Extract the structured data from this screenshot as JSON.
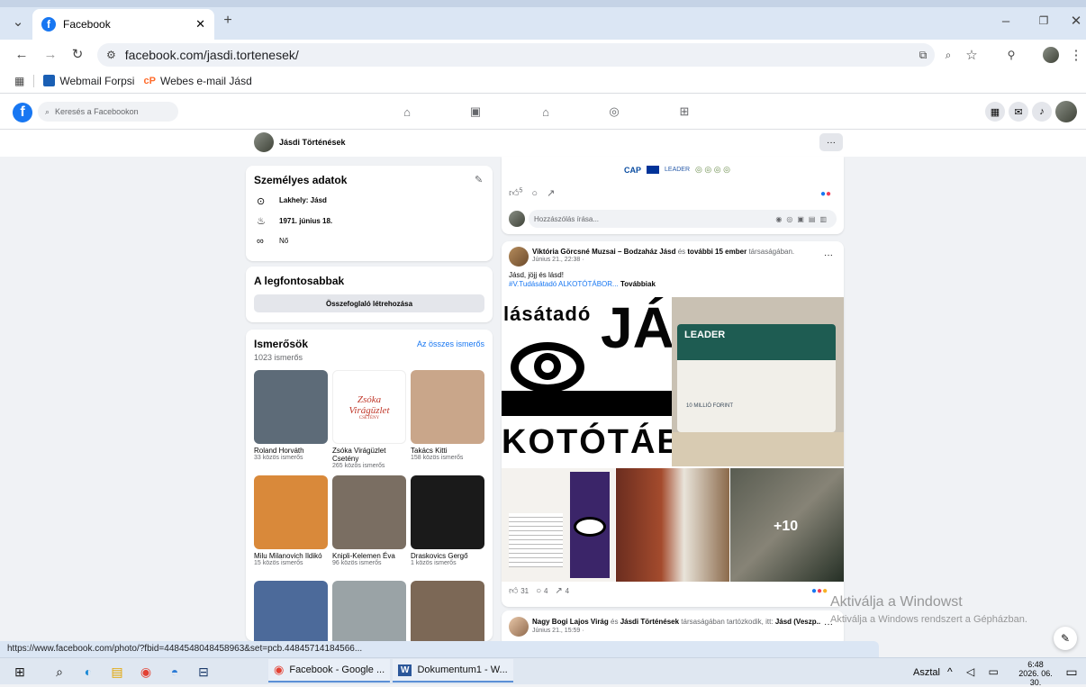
{
  "browser": {
    "tab_title": "Facebook",
    "url": "facebook.com/jasdi.tortenesek/",
    "bookmarks": [
      "Webmail Forpsi",
      "Webes e-mail Jásd"
    ],
    "status_url": "https://www.facebook.com/photo/?fbid=4484548048458963&set=pcb.44845714184566..."
  },
  "fb": {
    "search_placeholder": "Keresés a Facebookon",
    "page_name": "Jásdi Történések"
  },
  "personal": {
    "title": "Személyes adatok",
    "residence": "Lakhely: Jásd",
    "birthday": "1971. június 18.",
    "gender": "Nő"
  },
  "highlights": {
    "title": "A legfontosabbak",
    "button": "Összefoglaló létrehozása"
  },
  "friends": {
    "title": "Ismerősök",
    "see_all": "Az összes ismerős",
    "count": "1023 ismerős",
    "items": [
      {
        "name": "Roland Horváth",
        "mutual": "33 közös ismerős",
        "bg": "#5d6b78"
      },
      {
        "name": "Zsóka Virágüzlet Csetény",
        "mutual": "265 közös ismerős",
        "bg": "#ffffff"
      },
      {
        "name": "Takács Kitti",
        "mutual": "158 közös ismerős",
        "bg": "#c9a68a"
      },
      {
        "name": "Milu Milanovich Ildikó",
        "mutual": "15 közös ismerős",
        "bg": "#d9893a"
      },
      {
        "name": "Knipli-Kelemen Éva",
        "mutual": "96 közös ismerős",
        "bg": "#7a6e62"
      },
      {
        "name": "Draskovics Gergő",
        "mutual": "1 közös ismerős",
        "bg": "#1a1a1a"
      },
      {
        "name": "",
        "mutual": "",
        "bg": "#4c6a9a"
      },
      {
        "name": "",
        "mutual": "",
        "bg": "#9aa3a6"
      },
      {
        "name": "",
        "mutual": "",
        "bg": "#7c6856"
      }
    ],
    "logo_line1": "Zsóka",
    "logo_line2": "Virágüzlet",
    "logo_line3": "CSETÉNY"
  },
  "post1": {
    "likes": "5",
    "comment_placeholder": "Hozzászólás írása..."
  },
  "post2": {
    "author": "Viktória Görcsné Muzsai – Bodzaház Jásd",
    "with_text": "és",
    "others": "további 15 ember",
    "suffix": "társaságában.",
    "time": "Június 21., 22:38 ·",
    "text1": "Jásd, jöjj és lásd!",
    "hashtag": "#V.Tudásátadó ALKOTÓTÁBOR...",
    "more": "Továbbiak",
    "img_word1": "lásátadó",
    "img_word2": "JÁS",
    "img_word3": "KOTÓTÁB",
    "leader_title": "LEADER",
    "leader_amount": "10 MILLIÓ FORINT",
    "plus_more": "+10",
    "likes": "31",
    "comments": "4",
    "shares": "4",
    "banner_text": "CAP",
    "banner_leader": "LEADER"
  },
  "post3": {
    "author": "Nagy Bogi Lajos Virág",
    "connector": "és",
    "page": "Jásdi Történések",
    "suffix": "társaságában tartózkodik, itt:",
    "place": "Jásd (Veszp...",
    "time": "Június 21., 15:59 ·"
  },
  "watermark": {
    "line1": "Aktiválja a Windowst",
    "line2": "Aktiválja a Windows rendszert a Gépházban."
  },
  "taskbar": {
    "app1": "Facebook - Google ...",
    "app2": "Dokumentum1 - W...",
    "desktop": "Asztal",
    "time": "6:48",
    "date": "2026. 06. 30."
  }
}
